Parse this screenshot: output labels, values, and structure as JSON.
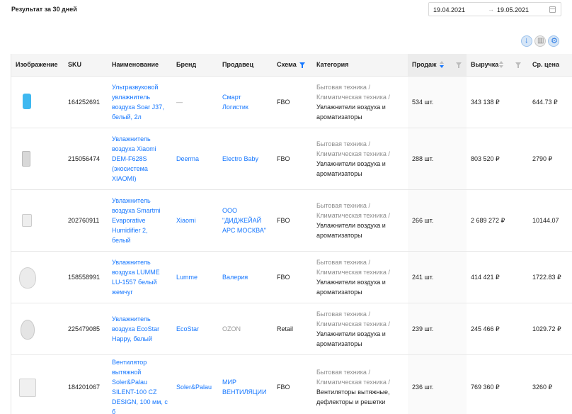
{
  "header": {
    "period_label": "Результат за 30 дней",
    "date_from": "19.04.2021",
    "date_arrow": "→",
    "date_to": "19.05.2021"
  },
  "toolbar": {
    "icons": [
      "download-icon",
      "columns-icon",
      "settings-icon"
    ]
  },
  "table": {
    "columns": {
      "image": "Изображение",
      "sku": "SKU",
      "name": "Наименование",
      "brand": "Бренд",
      "seller": "Продавец",
      "scheme": "Схема",
      "category": "Категория",
      "sold": "Продаж",
      "revenue": "Выручка",
      "avg_price": "Ср. цена"
    },
    "rows": [
      {
        "image_color": "#3fb8f0",
        "sku": "164252691",
        "name": "Ультразвуковой увлажнитель воздуха Soar J37, белый, 2л",
        "brand": "—",
        "seller": "Смарт Логистик",
        "scheme": "FBO",
        "cat1": "Бытовая техника",
        "cat2": "Климатическая техника",
        "cat3": "Увлажнители воздуха и ароматизаторы",
        "sold": "534 шт.",
        "revenue": "343 138 ₽",
        "avg_price": "644.73 ₽"
      },
      {
        "image_color": "#d8d8d8",
        "sku": "215056474",
        "name": "Увлажнитель воздуха Xiaomi DEM-F628S (экосистема XIAOMI)",
        "brand": "Deerma",
        "seller": "Electro Baby",
        "scheme": "FBO",
        "cat1": "Бытовая техника",
        "cat2": "Климатическая техника",
        "cat3": "Увлажнители воздуха и ароматизаторы",
        "sold": "288 шт.",
        "revenue": "803 520 ₽",
        "avg_price": "2790 ₽"
      },
      {
        "image_color": "#eeeeee",
        "sku": "202760911",
        "name": "Увлажнитель воздуха Smartmi Evaporative Humidifier 2, белый",
        "brand": "Xiaomi",
        "seller": "ООО \"ДИДЖЕЙАЙ АРС МОСКВА\"",
        "scheme": "FBO",
        "cat1": "Бытовая техника",
        "cat2": "Климатическая техника",
        "cat3": "Увлажнители воздуха и ароматизаторы",
        "sold": "266 шт.",
        "revenue": "2 689 272 ₽",
        "avg_price": "10144.07"
      },
      {
        "image_color": "#ebebeb",
        "sku": "158558991",
        "name": "Увлажнитель воздуха LUMME LU-1557 белый жемчуг",
        "brand": "Lumme",
        "seller": "Валерия",
        "scheme": "FBO",
        "cat1": "Бытовая техника",
        "cat2": "Климатическая техника",
        "cat3": "Увлажнители воздуха и ароматизаторы",
        "sold": "241 шт.",
        "revenue": "414 421 ₽",
        "avg_price": "1722.83 ₽"
      },
      {
        "image_color": "#e4e4e4",
        "sku": "225479085",
        "name": "Увлажнитель воздуха EcoStar Happy, белый",
        "brand": "EcoStar",
        "seller": "OZON",
        "scheme": "Retail",
        "cat1": "Бытовая техника",
        "cat2": "Климатическая техника",
        "cat3": "Увлажнители воздуха и ароматизаторы",
        "sold": "239 шт.",
        "revenue": "245 466 ₽",
        "avg_price": "1029.72 ₽"
      },
      {
        "image_color": "#f0f0f0",
        "sku": "184201067",
        "name": "Вентилятор вытяжной Soler&Palau SILENT-100 CZ DESIGN, 100 мм, с б",
        "brand": "Soler&Palau",
        "seller": "МИР ВЕНТИЛЯЦИИ",
        "scheme": "FBO",
        "cat1": "Бытовая техника",
        "cat2": "Климатическая техника",
        "cat3": "Вентиляторы вытяжные, дефлекторы и решетки",
        "sold": "236 шт.",
        "revenue": "769 360 ₽",
        "avg_price": "3260 ₽"
      }
    ]
  }
}
